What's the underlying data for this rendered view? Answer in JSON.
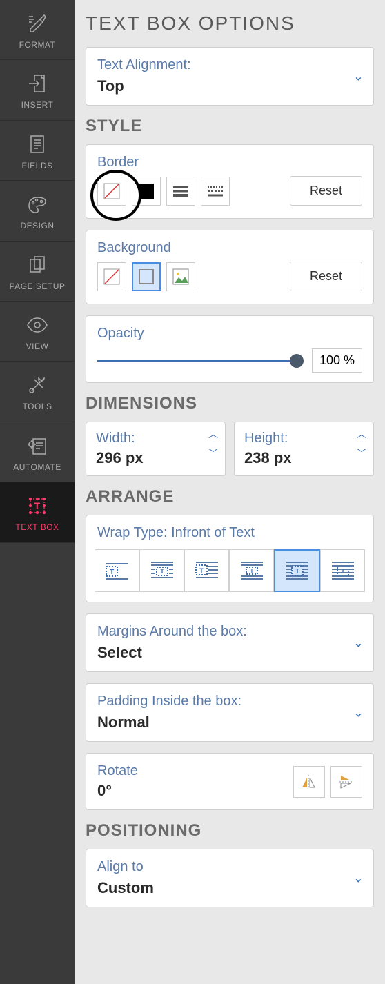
{
  "sidebar": {
    "items": [
      {
        "label": "FORMAT"
      },
      {
        "label": "INSERT"
      },
      {
        "label": "FIELDS"
      },
      {
        "label": "DESIGN"
      },
      {
        "label": "PAGE SETUP"
      },
      {
        "label": "VIEW"
      },
      {
        "label": "TOOLS"
      },
      {
        "label": "AUTOMATE"
      },
      {
        "label": "TEXT BOX"
      }
    ]
  },
  "panel": {
    "title": "TEXT BOX OPTIONS",
    "alignment": {
      "label": "Text Alignment:",
      "value": "Top"
    },
    "style": {
      "heading": "STYLE",
      "border": {
        "label": "Border",
        "reset": "Reset"
      },
      "background": {
        "label": "Background",
        "reset": "Reset"
      },
      "opacity": {
        "label": "Opacity",
        "value": "100 %"
      }
    },
    "dimensions": {
      "heading": "DIMENSIONS",
      "width": {
        "label": "Width:",
        "value": "296 px"
      },
      "height": {
        "label": "Height:",
        "value": "238 px"
      }
    },
    "arrange": {
      "heading": "ARRANGE",
      "wrap": {
        "label": "Wrap Type: Infront of Text"
      },
      "margins": {
        "label": "Margins Around the box:",
        "value": "Select"
      },
      "padding": {
        "label": "Padding Inside the box:",
        "value": "Normal"
      },
      "rotate": {
        "label": "Rotate",
        "value": "0°"
      }
    },
    "positioning": {
      "heading": "POSITIONING",
      "align": {
        "label": "Align to",
        "value": "Custom"
      }
    }
  }
}
